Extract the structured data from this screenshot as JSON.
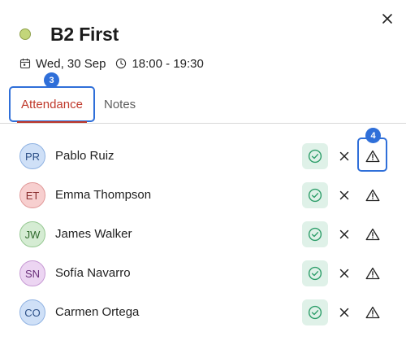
{
  "event": {
    "title": "B2 First",
    "date": "Wed, 30 Sep",
    "time": "18:00 - 19:30",
    "colors": {
      "dot": "#c3d67a"
    }
  },
  "tabs": [
    {
      "label": "Attendance",
      "active": true
    },
    {
      "label": "Notes",
      "active": false
    }
  ],
  "annotations": {
    "tab_badge": "3",
    "warn_badge": "4"
  },
  "students": [
    {
      "initials": "PR",
      "name": "Pablo Ruiz",
      "bg": "#cfe0f7",
      "border": "#8fb2e2",
      "fg": "#2c4f86"
    },
    {
      "initials": "ET",
      "name": "Emma Thompson",
      "bg": "#f7cfcf",
      "border": "#e19a9a",
      "fg": "#8a2f2f"
    },
    {
      "initials": "JW",
      "name": "James Walker",
      "bg": "#d5ecd3",
      "border": "#97c993",
      "fg": "#2f6a2c"
    },
    {
      "initials": "SN",
      "name": "Sofía Navarro",
      "bg": "#ecd5f2",
      "border": "#c79ad4",
      "fg": "#6a2f7a"
    },
    {
      "initials": "CO",
      "name": "Carmen Ortega",
      "bg": "#cfe0f7",
      "border": "#8fb2e2",
      "fg": "#2c4f86"
    }
  ],
  "icons": {
    "close": "close-icon",
    "calendar": "calendar-icon",
    "clock": "clock-icon",
    "present": "check-circle-icon",
    "absent": "x-icon",
    "issue": "warning-triangle-icon"
  },
  "accent": {
    "blue": "#2f6fd9",
    "red": "#c0392b",
    "green": "#2e9e6a"
  }
}
